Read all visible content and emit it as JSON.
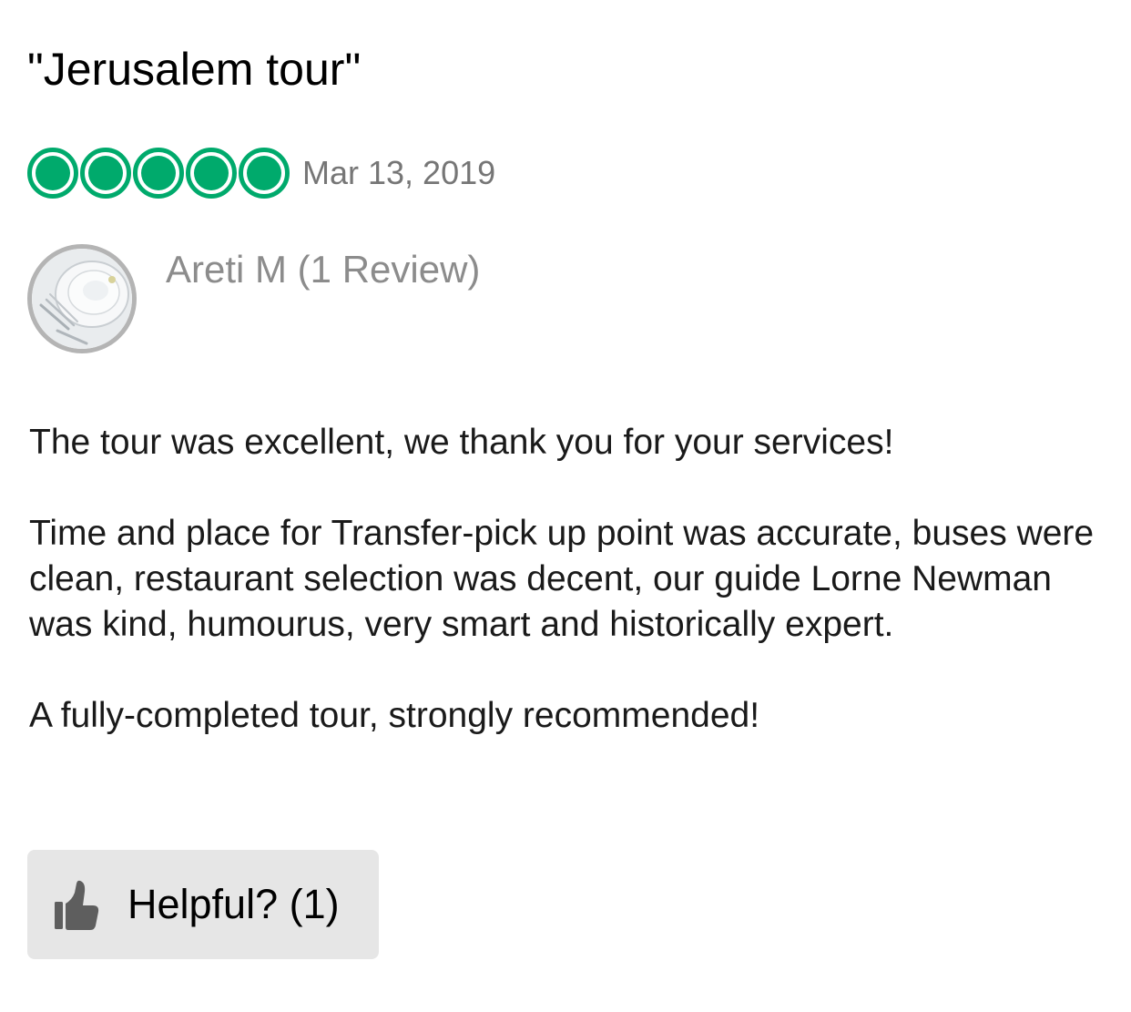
{
  "review": {
    "title": "\"Jerusalem tour\"",
    "rating": 5,
    "rating_max": 5,
    "date": "Mar 13, 2019",
    "reviewer": "Areti M (1 Review)",
    "paragraphs": [
      "The tour was excellent, we thank you for your services!",
      "Time and place for Transfer-pick up point was accurate, buses were clean, restaurant selection was decent, our guide Lorne Newman was kind, humourus, very smart and historically expert.",
      "A fully-completed tour, strongly recommended!"
    ]
  },
  "helpful": {
    "label": "Helpful? (1)",
    "icon": "thumbs-up-icon"
  },
  "colors": {
    "rating_green": "#00aa6c",
    "date_gray": "#767676",
    "reviewer_gray": "#8c8c8c",
    "button_bg": "#e6e6e6"
  }
}
